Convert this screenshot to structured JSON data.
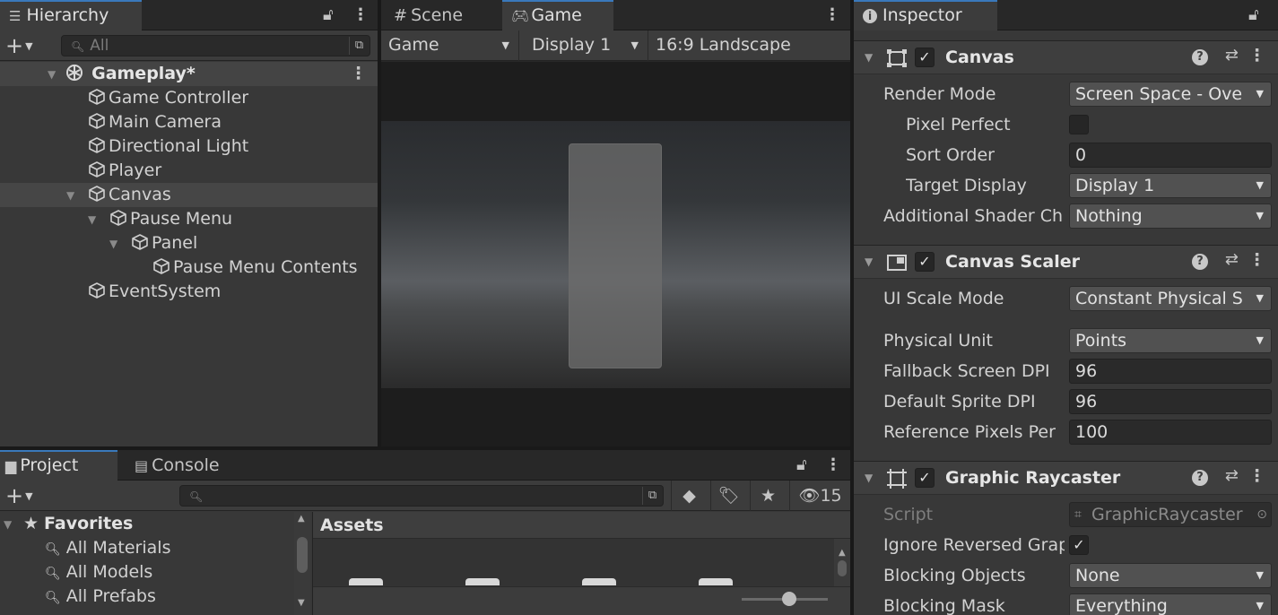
{
  "hierarchy": {
    "tab_label": "Hierarchy",
    "search_placeholder": "All",
    "scene_name": "Gameplay*",
    "items": [
      {
        "label": "Game Controller"
      },
      {
        "label": "Main Camera"
      },
      {
        "label": "Directional Light"
      },
      {
        "label": "Player"
      },
      {
        "label": "Canvas"
      },
      {
        "label": "Pause Menu"
      },
      {
        "label": "Panel"
      },
      {
        "label": "Pause Menu Contents"
      },
      {
        "label": "EventSystem"
      }
    ]
  },
  "center": {
    "tabs": [
      {
        "label": "Scene"
      },
      {
        "label": "Game"
      }
    ],
    "toolbar": {
      "mode": "Game",
      "display": "Display 1",
      "aspect": "16:9 Landscape"
    }
  },
  "inspector": {
    "tab_label": "Inspector",
    "canvas": {
      "title": "Canvas",
      "render_mode_label": "Render Mode",
      "render_mode_value": "Screen Space - Ove",
      "pixel_perfect_label": "Pixel Perfect",
      "sort_order_label": "Sort Order",
      "sort_order_value": "0",
      "target_display_label": "Target Display",
      "target_display_value": "Display 1",
      "shader_label": "Additional Shader Ch",
      "shader_value": "Nothing"
    },
    "scaler": {
      "title": "Canvas Scaler",
      "scale_mode_label": "UI Scale Mode",
      "scale_mode_value": "Constant Physical S",
      "physical_unit_label": "Physical Unit",
      "physical_unit_value": "Points",
      "fallback_dpi_label": "Fallback Screen DPI",
      "fallback_dpi_value": "96",
      "sprite_dpi_label": "Default Sprite DPI",
      "sprite_dpi_value": "96",
      "ref_pixels_label": "Reference Pixels Per",
      "ref_pixels_value": "100"
    },
    "raycaster": {
      "title": "Graphic Raycaster",
      "script_label": "Script",
      "script_value": "GraphicRaycaster",
      "ignore_reversed_label": "Ignore Reversed Grap",
      "blocking_objects_label": "Blocking Objects",
      "blocking_objects_value": "None",
      "blocking_mask_label": "Blocking Mask",
      "blocking_mask_value": "Everything"
    }
  },
  "project": {
    "tabs": [
      {
        "label": "Project"
      },
      {
        "label": "Console"
      }
    ],
    "hidden_count": "15",
    "favorites_label": "Favorites",
    "favorites": [
      {
        "label": "All Materials"
      },
      {
        "label": "All Models"
      },
      {
        "label": "All Prefabs"
      }
    ],
    "assets_label": "Assets",
    "zoom_fraction": 0.55
  }
}
